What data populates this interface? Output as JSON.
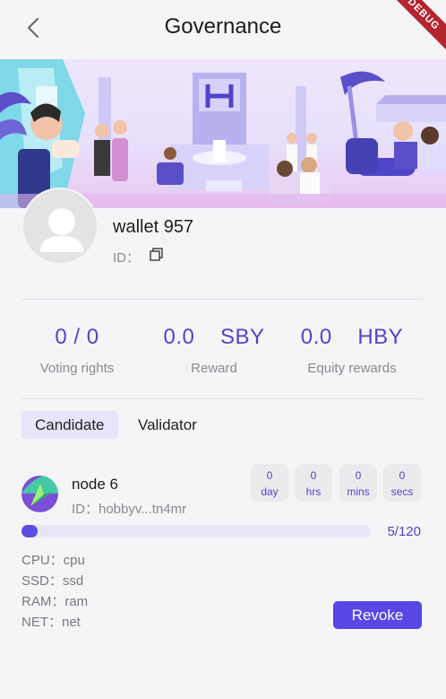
{
  "header": {
    "title": "Governance",
    "debug_label": "DEBUG"
  },
  "profile": {
    "wallet_name": "wallet 957",
    "id_label": "ID："
  },
  "stats": [
    {
      "value": "0 / 0",
      "label": "Voting rights"
    },
    {
      "value": "0.0    SBY",
      "label": "Reward"
    },
    {
      "value": "0.0    HBY",
      "label": "Equity rewards"
    }
  ],
  "tabs": [
    {
      "label": "Candidate",
      "active": true
    },
    {
      "label": "Validator",
      "active": false
    }
  ],
  "node": {
    "name": "node 6",
    "id": "ID：hobbyv...tn4mr",
    "timer": [
      {
        "value": "0",
        "unit": "day"
      },
      {
        "value": "0",
        "unit": "hrs"
      },
      {
        "value": "0",
        "unit": "mins"
      },
      {
        "value": "0",
        "unit": "secs"
      }
    ],
    "progress_text": "5/120",
    "progress_fraction": 0.042,
    "specs": [
      "CPU：cpu",
      "SSD：ssd",
      "RAM：ram",
      "NET：net"
    ],
    "revoke_label": "Revoke"
  },
  "colors": {
    "accent": "#4f45c8",
    "button": "#5747e4",
    "progress_track": "#e7e7f8"
  }
}
